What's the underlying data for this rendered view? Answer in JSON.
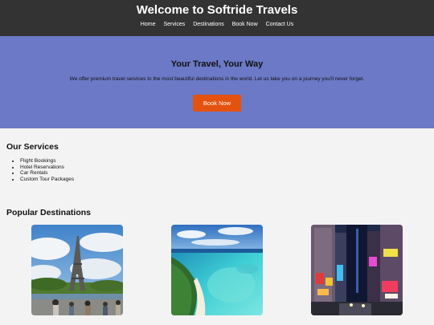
{
  "header": {
    "title": "Welcome to Softride Travels",
    "nav": [
      "Home",
      "Services",
      "Destinations",
      "Book Now",
      "Contact Us"
    ]
  },
  "hero": {
    "heading": "Your Travel, Your Way",
    "text": "We offer premium travel services to the most beautiful destinations in the world. Let us take you on a journey you'll never forget.",
    "button": "Book Now"
  },
  "services": {
    "title": "Our Services",
    "items": [
      "Flight Bookings",
      "Hotel Reservations",
      "Car Rentals",
      "Custom Tour Packages"
    ]
  },
  "destinations": {
    "title": "Popular Destinations",
    "items": [
      {
        "name": "",
        "image": "eiffel-tower-photo"
      },
      {
        "name": "",
        "image": "tropical-beach-photo"
      },
      {
        "name": "",
        "image": "city-night-street-photo"
      }
    ]
  },
  "colors": {
    "header_bg": "#333333",
    "hero_bg": "#6b79c6",
    "button_bg": "#e4520f",
    "page_bg": "#f4f3f4"
  }
}
